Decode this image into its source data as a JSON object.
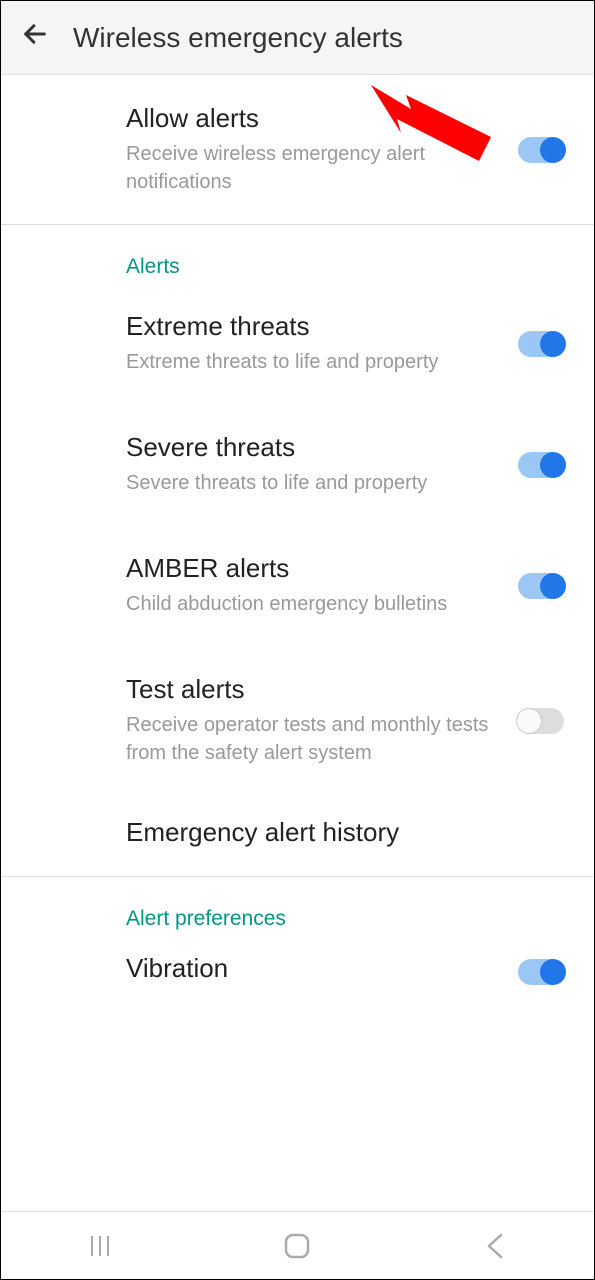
{
  "header": {
    "title": "Wireless emergency alerts"
  },
  "allow_alerts": {
    "title": "Allow alerts",
    "subtitle": "Receive wireless emergency alert notifications",
    "enabled": true
  },
  "sections": {
    "alerts": {
      "header": "Alerts",
      "items": [
        {
          "title": "Extreme threats",
          "subtitle": "Extreme threats to life and property",
          "enabled": true
        },
        {
          "title": "Severe threats",
          "subtitle": "Severe threats to life and property",
          "enabled": true
        },
        {
          "title": "AMBER alerts",
          "subtitle": "Child abduction emergency bulletins",
          "enabled": true
        },
        {
          "title": "Test alerts",
          "subtitle": "Receive operator tests and monthly tests from the safety alert system",
          "enabled": false
        }
      ],
      "history_label": "Emergency alert history"
    },
    "preferences": {
      "header": "Alert preferences",
      "items": [
        {
          "title": "Vibration",
          "enabled": true
        }
      ]
    }
  },
  "annotation": {
    "arrow_color": "#ff0000"
  }
}
